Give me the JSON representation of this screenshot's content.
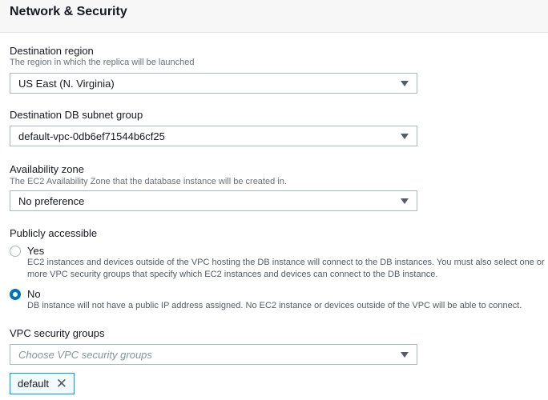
{
  "header": {
    "title": "Network & Security"
  },
  "destination_region": {
    "label": "Destination region",
    "help": "The region in which the replica will be launched",
    "value": "US East (N. Virginia)"
  },
  "subnet_group": {
    "label": "Destination DB subnet group",
    "value": "default-vpc-0db6ef71544b6cf25"
  },
  "availability_zone": {
    "label": "Availability zone",
    "help": "The EC2 Availability Zone that the database instance will be created in.",
    "value": "No preference"
  },
  "publicly_accessible": {
    "label": "Publicly accessible",
    "options": [
      {
        "label": "Yes",
        "desc": "EC2 instances and devices outside of the VPC hosting the DB instance will connect to the DB instances. You must also select one or more VPC security groups that specify which EC2 instances and devices can connect to the DB instance.",
        "selected": false
      },
      {
        "label": "No",
        "desc": "DB instance will not have a public IP address assigned. No EC2 instance or devices outside of the VPC will be able to connect.",
        "selected": true
      }
    ]
  },
  "vpc_security_groups": {
    "label": "VPC security groups",
    "placeholder": "Choose VPC security groups",
    "tags": [
      "default"
    ]
  }
}
